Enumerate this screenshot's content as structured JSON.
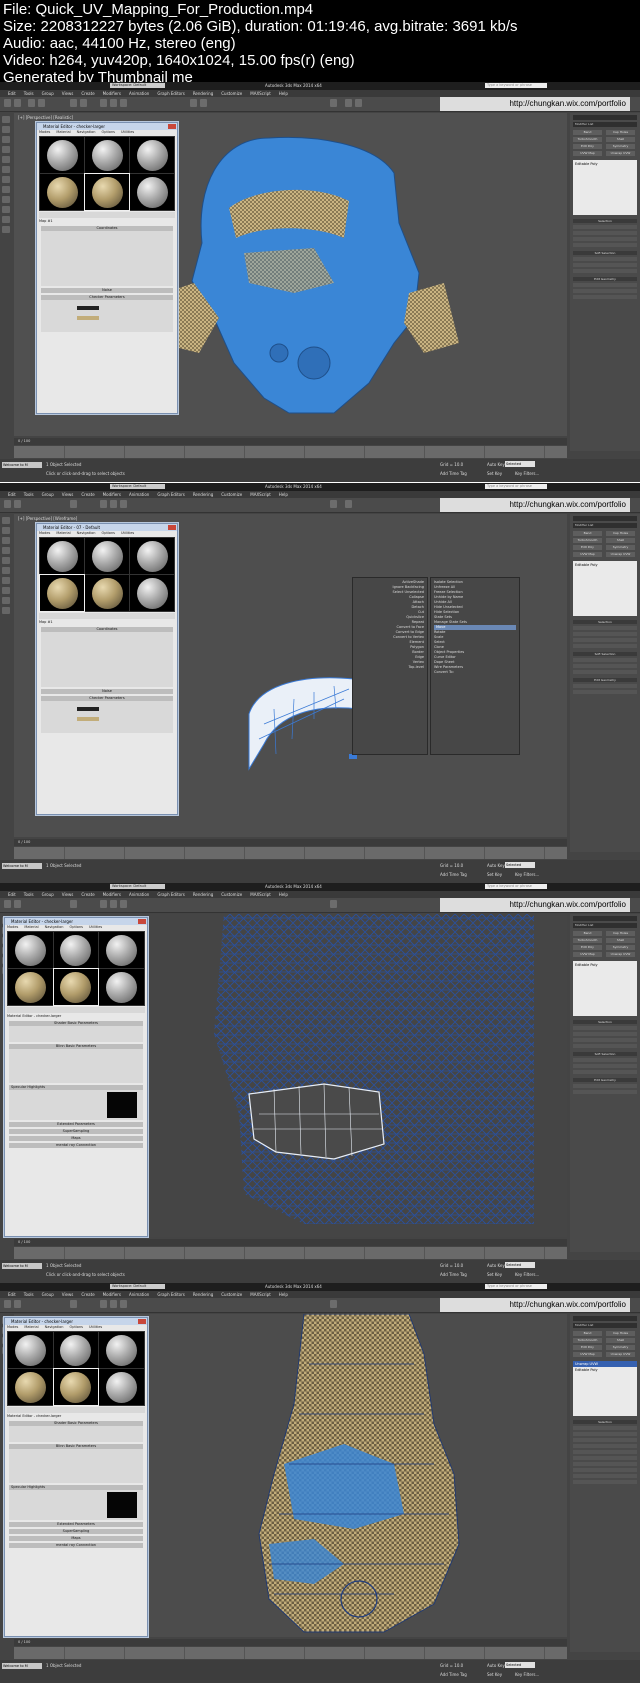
{
  "file_info": {
    "file": "File: Quick_UV_Mapping_For_Production.mp4",
    "size": "Size: 2208312227 bytes (2.06 GiB), duration: 01:19:46, avg.bitrate: 3691 kb/s",
    "audio": "Audio: aac, 44100 Hz, stereo (eng)",
    "video": "Video: h264, yuv420p, 1640x1024, 15.00 fps(r) (eng)",
    "generator": "Generated by Thumbnail me"
  },
  "app": {
    "workspace": "Workspace: Default",
    "title": "Autodesk 3ds Max 2014 x64",
    "search_placeholder": "Type a keyword or phrase",
    "url": "http://chungkan.wix.com/portfolio",
    "menus": [
      "Edit",
      "Tools",
      "Group",
      "Views",
      "Create",
      "Modifiers",
      "Animation",
      "Graph Editors",
      "Rendering",
      "Customize",
      "MAXScript",
      "Help"
    ],
    "status_left": "Welcome to M",
    "status_selected": "1 Object Selected",
    "status_hint": "Click or click-and-drag to select objects",
    "grid": "Grid = 10.0",
    "auto_key": "Auto Key",
    "set_key": "Set Key",
    "selected": "Selected",
    "key_filters": "Key Filters...",
    "add_time_tag": "Add Time Tag",
    "frame_counter": "0 / 100"
  },
  "command_panel": {
    "modifier_list": "Modifier List",
    "buttons": [
      "Bend",
      "Cap Holes",
      "TurboSmooth",
      "Shell",
      "Edit Poly",
      "Symmetry",
      "UVW Map",
      "Unwrap UVW"
    ],
    "stack_item": "Editable Poly",
    "selection": "Selection",
    "soft_selection": "Soft Selection",
    "edit_geometry": "Edit Geometry"
  },
  "frames": [
    {
      "viewport_label": "[+] [Perspective] [Realistic]",
      "mat_title": "Material Editor - checker-larger",
      "map_name": "Map #1",
      "coordinates": "Coordinates",
      "noise": "Noise",
      "checker_params": "Checker Parameters",
      "color1": "Color",
      "color2": "Color"
    },
    {
      "viewport_label": "[+] [Perspective] [Wireframe]",
      "mat_title": "Material Editor - 07 - Default",
      "map_name": "Map #1",
      "coordinates": "Coordinates",
      "noise": "Noise",
      "checker_params": "Checker Parameters",
      "quad_items": [
        "Isolate Selection",
        "Unfreeze All",
        "Freeze Selection",
        "Unhide by Name",
        "Unhide All",
        "Hide Unselected",
        "Hide Selection",
        "State Sets",
        "Manage State Sets",
        "Move",
        "Rotate",
        "Scale",
        "Select",
        "Clone",
        "Object Properties",
        "Curve Editor",
        "Dope Sheet",
        "Wire Parameters",
        "Convert To:"
      ]
    },
    {
      "viewport_label": "[+] [Orthographic] [Wireframe]",
      "mat_title": "Material Editor - checker-larger",
      "shader_params": "Shader Basic Parameters",
      "blinn_params": "Blinn Basic Parameters",
      "spec_highlights": "Specular Highlights",
      "rollouts": [
        "Extended Parameters",
        "SuperSampling",
        "Maps",
        "mental ray Connection"
      ]
    },
    {
      "viewport_label": "[+] [Orthographic] [Realistic + Edged Faces]",
      "mat_title": "Material Editor - checker-larger",
      "shader_params": "Shader Basic Parameters",
      "blinn_params": "Blinn Basic Parameters",
      "spec_highlights": "Specular Highlights",
      "rollouts": [
        "Extended Parameters",
        "SuperSampling",
        "Maps",
        "mental ray Connection"
      ],
      "stack_top": "Unwrap UVW",
      "stack_bottom": "Editable Poly"
    }
  ],
  "colors": {
    "helmet_blue": "#3a86d6",
    "checker_tan": "#c2ad7a",
    "wire_white": "#e8eef6",
    "mesh_blue": "#2850a0"
  }
}
